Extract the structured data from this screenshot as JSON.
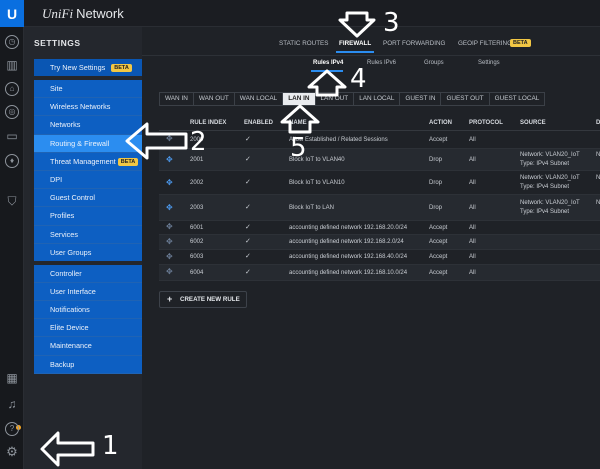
{
  "app": {
    "logo": "U",
    "brand_script": "UniFi",
    "brand_text": "Network"
  },
  "rail_icons": [
    "dashboard-icon",
    "statistics-icon",
    "map-icon",
    "devices-icon",
    "clients-icon",
    "insights-icon",
    "shield-icon",
    "events-icon",
    "alerts-icon",
    "help-icon",
    "settings-gear-icon"
  ],
  "settings": {
    "title": "SETTINGS",
    "try_new": "Try New Settings",
    "beta": "BETA",
    "items": [
      "Site",
      "Wireless Networks",
      "Networks",
      "Routing & Firewall",
      "Threat Management",
      "DPI",
      "Guest Control",
      "Profiles",
      "Services",
      "User Groups"
    ],
    "items2": [
      "Controller",
      "User Interface",
      "Notifications",
      "Elite Device",
      "Maintenance",
      "Backup"
    ]
  },
  "top_tabs": [
    "STATIC ROUTES",
    "FIREWALL",
    "PORT FORWARDING",
    "GEOIP FILTERING"
  ],
  "top_tab_badge": "BETA",
  "sub_tabs": [
    "Rules IPv4",
    "Rules IPv6",
    "Groups",
    "Settings"
  ],
  "segments": [
    "WAN IN",
    "WAN OUT",
    "WAN LOCAL",
    "LAN IN",
    "LAN OUT",
    "LAN LOCAL",
    "GUEST IN",
    "GUEST OUT",
    "GUEST LOCAL"
  ],
  "table": {
    "headers": [
      "RULE INDEX",
      "ENABLED",
      "NAME",
      "ACTION",
      "PROTOCOL",
      "SOURCE",
      "D"
    ],
    "rows": [
      {
        "index": "2000",
        "name": "Allow Established / Related Sessions",
        "action": "Accept",
        "protocol": "All",
        "source1": "",
        "source2": "",
        "dest": ""
      },
      {
        "index": "2001",
        "name": "Block IoT to VLAN40",
        "action": "Drop",
        "protocol": "All",
        "source1": "Network: VLAN20_IoT",
        "source2": "Type: IPv4 Subnet",
        "dest": "N"
      },
      {
        "index": "2002",
        "name": "Block IoT to VLAN10",
        "action": "Drop",
        "protocol": "All",
        "source1": "Network: VLAN20_IoT",
        "source2": "Type: IPv4 Subnet",
        "dest": "N"
      },
      {
        "index": "2003",
        "name": "Block IoT to LAN",
        "action": "Drop",
        "protocol": "All",
        "source1": "Network: VLAN20_IoT",
        "source2": "Type: IPv4 Subnet",
        "dest": "N"
      },
      {
        "index": "6001",
        "name": "accounting defined network 192.168.20.0/24",
        "action": "Accept",
        "protocol": "All",
        "source1": "",
        "source2": "",
        "dest": ""
      },
      {
        "index": "6002",
        "name": "accounting defined network 192.168.2.0/24",
        "action": "Accept",
        "protocol": "All",
        "source1": "",
        "source2": "",
        "dest": ""
      },
      {
        "index": "6003",
        "name": "accounting defined network 192.168.40.0/24",
        "action": "Accept",
        "protocol": "All",
        "source1": "",
        "source2": "",
        "dest": ""
      },
      {
        "index": "6004",
        "name": "accounting defined network 192.168.10.0/24",
        "action": "Accept",
        "protocol": "All",
        "source1": "",
        "source2": "",
        "dest": ""
      }
    ]
  },
  "create_rule": "CREATE NEW RULE",
  "annotations": [
    "1",
    "2",
    "3",
    "4",
    "5"
  ]
}
